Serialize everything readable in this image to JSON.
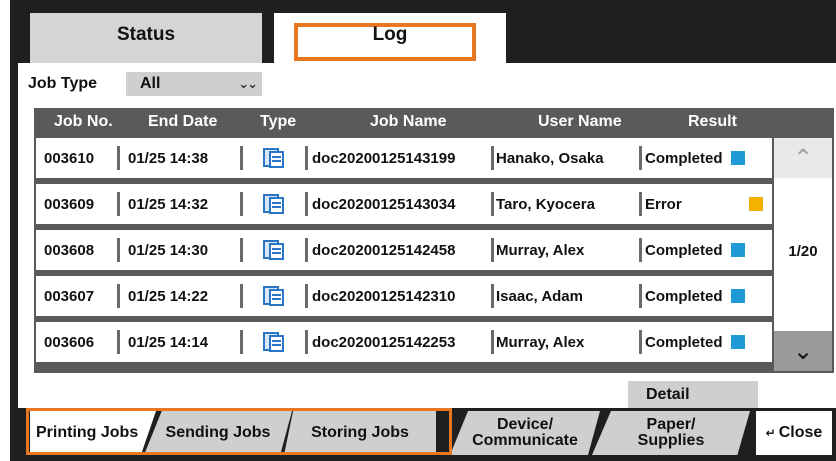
{
  "tabs": {
    "status": "Status",
    "log": "Log"
  },
  "filter": {
    "label": "Job Type",
    "value": "All",
    "icon": "double-chevron-down-icon"
  },
  "columns": [
    "Job No.",
    "End Date",
    "Type",
    "Job Name",
    "User Name",
    "Result"
  ],
  "rows": [
    {
      "job_no": "003610",
      "end_date": "01/25 14:38",
      "type_icon": "print-job-icon",
      "job_name": "doc20200125143199",
      "user": "Hanako, Osaka",
      "result": "Completed",
      "status_color": "#1f9ad6"
    },
    {
      "job_no": "003609",
      "end_date": "01/25 14:32",
      "type_icon": "print-job-icon",
      "job_name": "doc20200125143034",
      "user": "Taro, Kyocera",
      "result": "Error",
      "status_color": "#f2b200"
    },
    {
      "job_no": "003608",
      "end_date": "01/25 14:30",
      "type_icon": "print-job-icon",
      "job_name": "doc20200125142458",
      "user": "Murray, Alex",
      "result": "Completed",
      "status_color": "#1f9ad6"
    },
    {
      "job_no": "003607",
      "end_date": "01/25 14:22",
      "type_icon": "print-job-icon",
      "job_name": "doc20200125142310",
      "user": "Isaac, Adam",
      "result": "Completed",
      "status_color": "#1f9ad6"
    },
    {
      "job_no": "003606",
      "end_date": "01/25 14:14",
      "type_icon": "print-job-icon",
      "job_name": "doc20200125142253",
      "user": "Murray, Alex",
      "result": "Completed",
      "status_color": "#1f9ad6"
    }
  ],
  "pagination": {
    "indicator": "1/20"
  },
  "detail_label": "Detail",
  "bottom_tabs": {
    "printing": "Printing Jobs",
    "sending": "Sending Jobs",
    "storing": "Storing Jobs",
    "device_line1": "Device/",
    "device_line2": "Communicate",
    "paper_line1": "Paper/",
    "paper_line2": "Supplies",
    "close": "Close",
    "close_icon": "return-arrow-icon"
  },
  "colors": {
    "highlight": "#e87722",
    "completed": "#1f9ad6",
    "error": "#f2b200"
  }
}
